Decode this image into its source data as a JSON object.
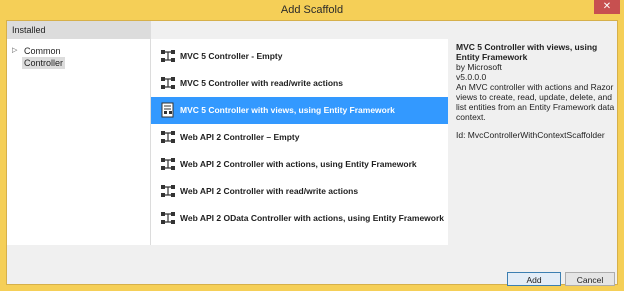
{
  "window": {
    "title": "Add Scaffold",
    "close_label": "✕"
  },
  "tree": {
    "header": "Installed",
    "items": [
      {
        "label": "Common",
        "expandable": true,
        "selected": false
      },
      {
        "label": "Controller",
        "expandable": false,
        "selected": true
      }
    ]
  },
  "list": {
    "items": [
      {
        "label": "MVC 5 Controller - Empty",
        "selected": false
      },
      {
        "label": "MVC 5 Controller with read/write actions",
        "selected": false
      },
      {
        "label": "MVC 5 Controller with views, using Entity Framework",
        "selected": true
      },
      {
        "label": "Web API 2 Controller – Empty",
        "selected": false
      },
      {
        "label": "Web API 2 Controller with actions, using Entity Framework",
        "selected": false
      },
      {
        "label": "Web API 2 Controller with read/write actions",
        "selected": false
      },
      {
        "label": "Web API 2 OData Controller with actions, using Entity Framework",
        "selected": false
      }
    ]
  },
  "details": {
    "title": "MVC 5 Controller with views, using Entity Framework",
    "author": "by Microsoft",
    "version": "v5.0.0.0",
    "description": "An MVC controller with actions and Razor views to create, read, update, delete, and list entities from an Entity Framework data context.",
    "id_line": "Id: MvcControllerWithContextScaffolder"
  },
  "buttons": {
    "add": "Add",
    "cancel": "Cancel"
  },
  "colors": {
    "frame": "#f5cf57",
    "selection": "#3399ff"
  }
}
